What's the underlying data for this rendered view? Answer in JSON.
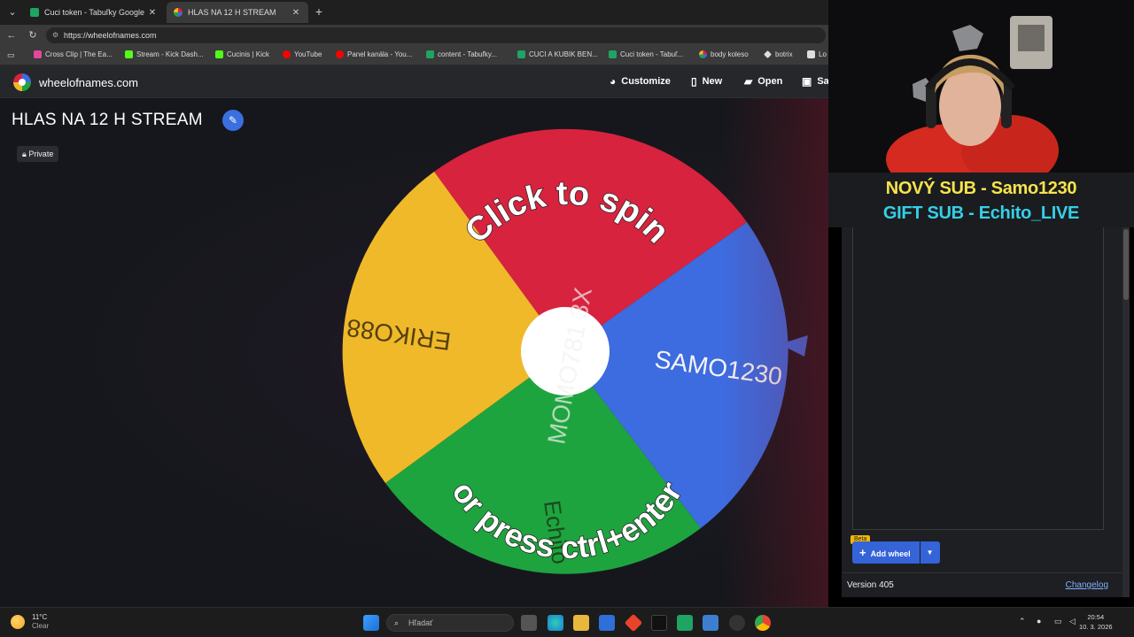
{
  "browser": {
    "tabs": [
      {
        "title": "Cuci token - Tabuľky Google",
        "favicon_color": "#1fa463"
      },
      {
        "title": "HLAS NA 12 H STREAM",
        "favicon_color": "#f2b800"
      }
    ],
    "url": "https://wheelofnames.com",
    "bookmarks": [
      {
        "label": "Cross Clip | The Ea...",
        "color": "#e0489a"
      },
      {
        "label": "Stream - Kick Dash...",
        "color": "#53fc18"
      },
      {
        "label": "Cucinis | Kick",
        "color": "#53fc18"
      },
      {
        "label": "YouTube",
        "color": "#ff0000"
      },
      {
        "label": "Panel kanála - You...",
        "color": "#ff0000"
      },
      {
        "label": "content - Tabuľky...",
        "color": "#1fa463"
      },
      {
        "label": "CUCI A KUBIK BEN...",
        "color": "#1fa463"
      },
      {
        "label": "Cuci token - Tabuľ...",
        "color": "#1fa463"
      },
      {
        "label": "body koleso",
        "color": "#f2b800"
      },
      {
        "label": "botrix",
        "color": "#dddddd"
      },
      {
        "label": "Lo",
        "color": "#dddddd"
      }
    ]
  },
  "site": {
    "logo_text": "wheelofnames.com",
    "menu": {
      "customize": "Customize",
      "new": "New",
      "open": "Open",
      "save": "Sa"
    }
  },
  "wheel": {
    "title": "HLAS NA 12 H STREAM",
    "privacy": "Private",
    "prompt_top": "Click to spin",
    "prompt_bottom": "or press ctrl+enter",
    "segments": [
      {
        "name": "MOMO781 3X",
        "color": "#d8233e"
      },
      {
        "name": "SAMO1230",
        "color": "#3d6ce0"
      },
      {
        "name": "Echito",
        "color": "#1ea43e"
      },
      {
        "name": "ERIKO88",
        "color": "#f0b92a"
      }
    ]
  },
  "overlay": {
    "line1": "NOVÝ SUB - Samo1230",
    "line2": "GIFT SUB - Echito_LIVE"
  },
  "panel": {
    "beta": "Beta",
    "add_wheel": "Add wheel",
    "version": "Version 405",
    "changelog": "Changelog"
  },
  "taskbar": {
    "weather_temp": "11°C",
    "weather_text": "Clear",
    "search_placeholder": "Hľadať",
    "time": "20:54",
    "date": "10. 3. 2026"
  }
}
